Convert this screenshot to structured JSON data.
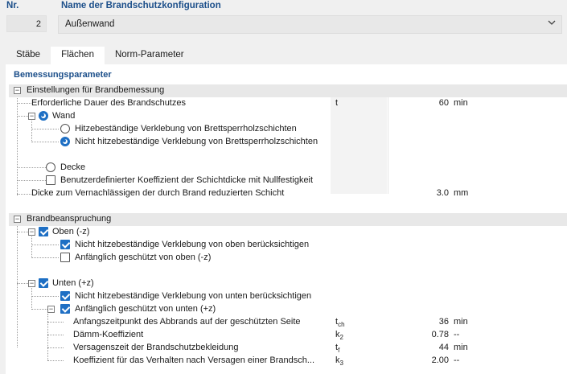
{
  "header": {
    "nr_label": "Nr.",
    "nr_value": "2",
    "name_label": "Name der Brandschutzkonfiguration",
    "name_value": "Außenwand"
  },
  "tabs": [
    {
      "label": "Stäbe",
      "active": false
    },
    {
      "label": "Flächen",
      "active": true
    },
    {
      "label": "Norm-Parameter",
      "active": false
    }
  ],
  "section_title": "Bemessungsparameter",
  "groups": {
    "design": "Einstellungen für Brandbemessung",
    "exposure": "Brandbeanspruchung"
  },
  "rows": {
    "duration": {
      "label": "Erforderliche Dauer des Brandschutzes",
      "symbol": "t",
      "value": "60",
      "unit": "min"
    },
    "wall": {
      "label": "Wand",
      "selected": true
    },
    "heat_resistant": {
      "label": "Hitzebeständige Verklebung von Brettsperrholzschichten",
      "selected": false
    },
    "non_heat_resistant": {
      "label": "Nicht hitzebeständige Verklebung von Brettsperrholzschichten",
      "selected": true
    },
    "ceiling": {
      "label": "Decke",
      "selected": false
    },
    "user_coef": {
      "label": "Benutzerdefinierter Koeffizient der Schichtdicke mit Nullfestigkeit",
      "checked": false
    },
    "neglect_thickness": {
      "label": "Dicke zum Vernachlässigen der durch Brand reduzierten Schicht",
      "value": "3.0",
      "unit": "mm"
    },
    "top": {
      "label": "Oben (-z)",
      "checked": true
    },
    "top_nonheat": {
      "label": "Nicht hitzebeständige Verklebung von oben berücksichtigen",
      "checked": true
    },
    "top_protected": {
      "label": "Anfänglich geschützt von oben (-z)",
      "checked": false
    },
    "bottom": {
      "label": "Unten (+z)",
      "checked": true
    },
    "bottom_nonheat": {
      "label": "Nicht hitzebeständige Verklebung von unten berücksichtigen",
      "checked": true
    },
    "bottom_protected": {
      "label": "Anfänglich geschützt von unten (+z)",
      "checked": true
    },
    "tch": {
      "label": "Anfangszeitpunkt des Abbrands auf der geschützten Seite",
      "sym": "t",
      "sub": "ch",
      "value": "36",
      "unit": "min"
    },
    "k2": {
      "label": "Dämm-Koeffizient",
      "sym": "k",
      "sub": "2",
      "value": "0.78",
      "unit": "--"
    },
    "tf": {
      "label": "Versagenszeit der Brandschutzbekleidung",
      "sym": "t",
      "sub": "f",
      "value": "44",
      "unit": "min"
    },
    "k3": {
      "label": "Koeffizient für das Verhalten nach Versagen einer Brandsch...",
      "sym": "k",
      "sub": "3",
      "value": "2.00",
      "unit": "--"
    }
  },
  "colors": {
    "accent": "#1e6fc4",
    "heading": "#1c4f8a",
    "group_bg": "#e8e8e8"
  }
}
